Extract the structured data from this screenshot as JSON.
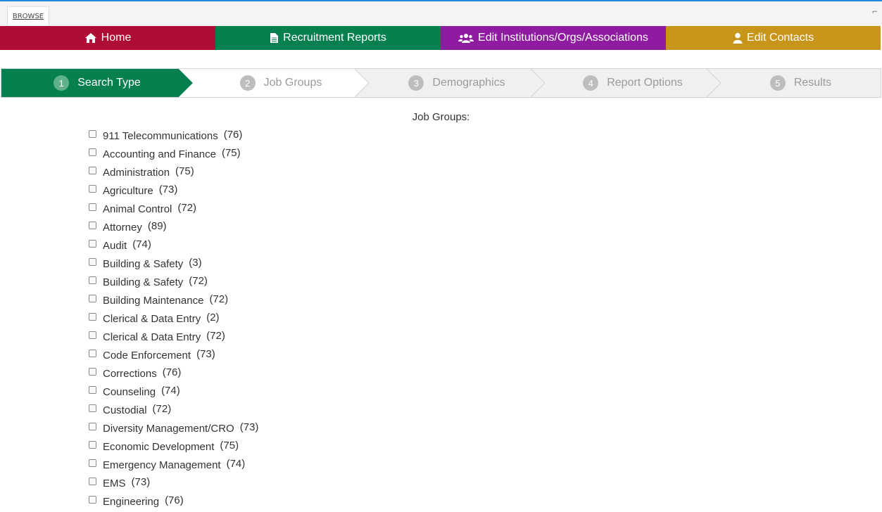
{
  "ribbon": {
    "tab_label": "BROWSE"
  },
  "nav": [
    {
      "label": "Home",
      "icon": "home-icon",
      "color": "#b00d36"
    },
    {
      "label": "Recruitment Reports",
      "icon": "document-icon",
      "color": "#07804f"
    },
    {
      "label": "Edit Institutions/Orgs/Associations",
      "icon": "users-icon",
      "color": "#8e1ba0"
    },
    {
      "label": "Edit Contacts",
      "icon": "user-icon",
      "color": "#c7951a"
    }
  ],
  "steps": [
    {
      "num": "1",
      "label": "Search Type",
      "active": true
    },
    {
      "num": "2",
      "label": "Job Groups",
      "active": false
    },
    {
      "num": "3",
      "label": "Demographics",
      "active": false
    },
    {
      "num": "4",
      "label": "Report Options",
      "active": false
    },
    {
      "num": "5",
      "label": "Results",
      "active": false
    }
  ],
  "colors": {
    "active_step": "#07804f",
    "inactive_step": "#f0f0f0",
    "step_white": "#ffffff"
  },
  "job_groups": {
    "heading": "Job Groups:",
    "items": [
      {
        "label": "911 Telecommunications",
        "count": "(76)"
      },
      {
        "label": "Accounting and Finance",
        "count": "(75)"
      },
      {
        "label": "Administration",
        "count": "(75)"
      },
      {
        "label": "Agriculture",
        "count": "(73)"
      },
      {
        "label": "Animal Control",
        "count": "(72)"
      },
      {
        "label": "Attorney",
        "count": "(89)"
      },
      {
        "label": "Audit",
        "count": "(74)"
      },
      {
        "label": "Building & Safety",
        "count": "(3)"
      },
      {
        "label": "Building & Safety",
        "count": "(72)"
      },
      {
        "label": "Building Maintenance",
        "count": "(72)"
      },
      {
        "label": "Clerical & Data Entry",
        "count": "(2)"
      },
      {
        "label": "Clerical & Data Entry",
        "count": "(72)"
      },
      {
        "label": "Code Enforcement",
        "count": "(73)"
      },
      {
        "label": "Corrections",
        "count": "(76)"
      },
      {
        "label": "Counseling",
        "count": "(74)"
      },
      {
        "label": "Custodial",
        "count": "(72)"
      },
      {
        "label": "Diversity Management/CRO",
        "count": "(73)"
      },
      {
        "label": "Economic Development",
        "count": "(75)"
      },
      {
        "label": "Emergency Management",
        "count": "(74)"
      },
      {
        "label": "EMS",
        "count": "(73)"
      },
      {
        "label": "Engineering",
        "count": "(76)"
      }
    ]
  }
}
